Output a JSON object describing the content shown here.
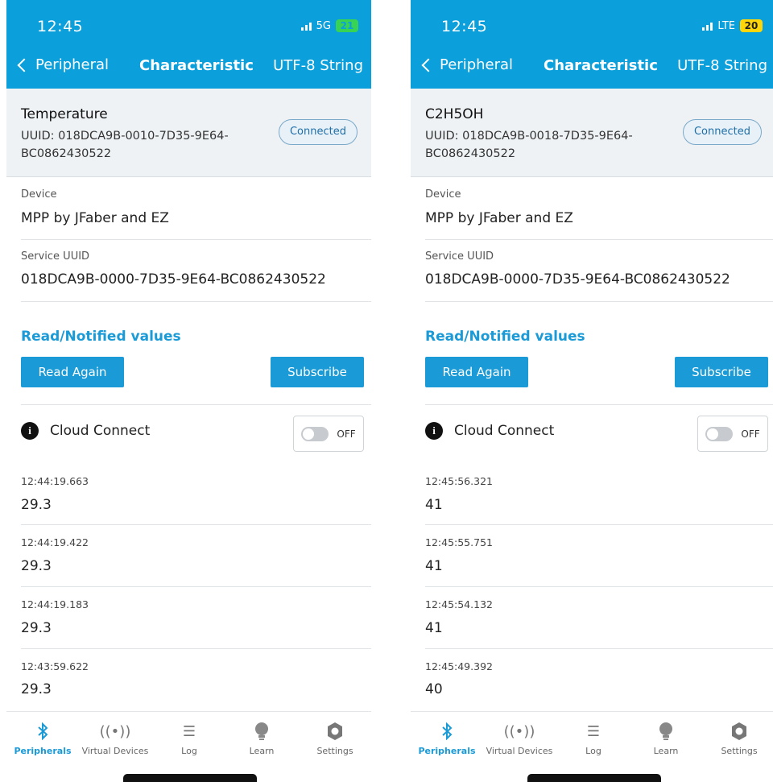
{
  "colors": {
    "accent": "#0b9fdb",
    "link": "#1a9ad6",
    "header_bg": "#eef2f5"
  },
  "left": {
    "status": {
      "time": "12:45",
      "network": "5G",
      "battery": "21"
    },
    "nav": {
      "back_label": "Peripheral",
      "title": "Characteristic",
      "right_label": "UTF-8 String"
    },
    "characteristic": {
      "name": "Temperature",
      "uuid": "UUID: 018DCA9B-0010-7D35-9E64-BC0862430522",
      "status": "Connected"
    },
    "device": {
      "label": "Device",
      "value": "MPP by JFaber and EZ"
    },
    "service": {
      "label": "Service UUID",
      "value": "018DCA9B-0000-7D35-9E64-BC0862430522"
    },
    "read_title": "Read/Notified values",
    "read_again": "Read Again",
    "subscribe": "Subscribe",
    "cloud_label": "Cloud Connect",
    "cloud_state": "OFF",
    "values": [
      {
        "time": "12:44:19.663",
        "value": "29.3"
      },
      {
        "time": "12:44:19.422",
        "value": "29.3"
      },
      {
        "time": "12:44:19.183",
        "value": "29.3"
      },
      {
        "time": "12:43:59.622",
        "value": "29.3"
      }
    ]
  },
  "right": {
    "status": {
      "time": "12:45",
      "network": "LTE",
      "battery": "20"
    },
    "nav": {
      "back_label": "Peripheral",
      "title": "Characteristic",
      "right_label": "UTF-8 String"
    },
    "characteristic": {
      "name": "C2H5OH",
      "uuid": "UUID: 018DCA9B-0018-7D35-9E64-BC0862430522",
      "status": "Connected"
    },
    "device": {
      "label": "Device",
      "value": "MPP by JFaber and EZ"
    },
    "service": {
      "label": "Service UUID",
      "value": "018DCA9B-0000-7D35-9E64-BC0862430522"
    },
    "read_title": "Read/Notified values",
    "read_again": "Read Again",
    "subscribe": "Subscribe",
    "cloud_label": "Cloud Connect",
    "cloud_state": "OFF",
    "values": [
      {
        "time": "12:45:56.321",
        "value": "41"
      },
      {
        "time": "12:45:55.751",
        "value": "41"
      },
      {
        "time": "12:45:54.132",
        "value": "41"
      },
      {
        "time": "12:45:49.392",
        "value": "40"
      }
    ]
  },
  "tabs": [
    {
      "label": "Peripherals",
      "icon": "bluetooth-icon",
      "active": true
    },
    {
      "label": "Virtual Devices",
      "icon": "broadcast-icon",
      "active": false
    },
    {
      "label": "Log",
      "icon": "list-icon",
      "active": false
    },
    {
      "label": "Learn",
      "icon": "lightbulb-icon",
      "active": false
    },
    {
      "label": "Settings",
      "icon": "gear-icon",
      "active": false
    }
  ]
}
